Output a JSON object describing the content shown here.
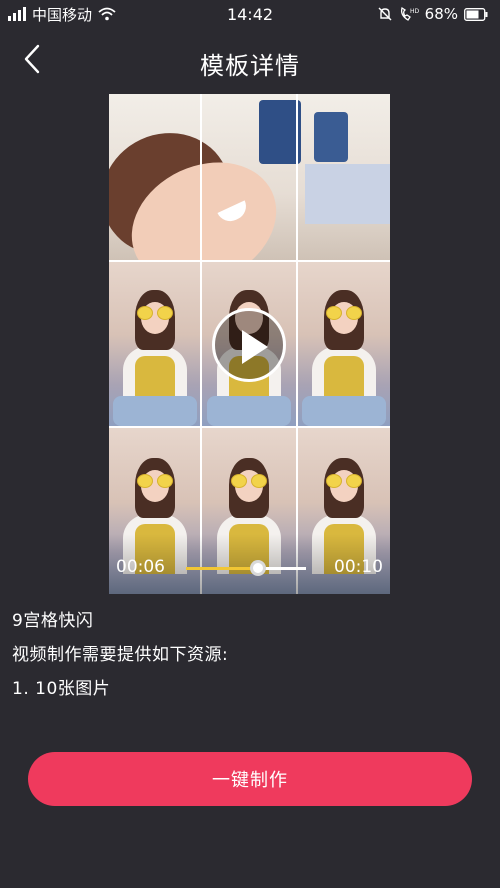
{
  "status_bar": {
    "carrier": "中国移动",
    "time": "14:42",
    "battery": "68%",
    "icons": [
      "signal-icon",
      "wifi-icon",
      "mute-icon",
      "hd-call-icon",
      "battery-icon"
    ]
  },
  "header": {
    "title": "模板详情",
    "back_icon": "chevron-left-icon"
  },
  "player": {
    "current_time": "00:06",
    "duration": "00:10",
    "progress": 0.6,
    "play_icon": "play-icon",
    "colors": {
      "progress": "#f1c634",
      "track": "#ffffff"
    }
  },
  "template": {
    "name": "9宫格快闪",
    "requirement": "视频制作需要提供如下资源:",
    "resources": [
      "1. 10张图片"
    ]
  },
  "action": {
    "make_label": "一键制作",
    "color": "#ef3a5d"
  },
  "theme": {
    "background": "#2b2a30"
  }
}
